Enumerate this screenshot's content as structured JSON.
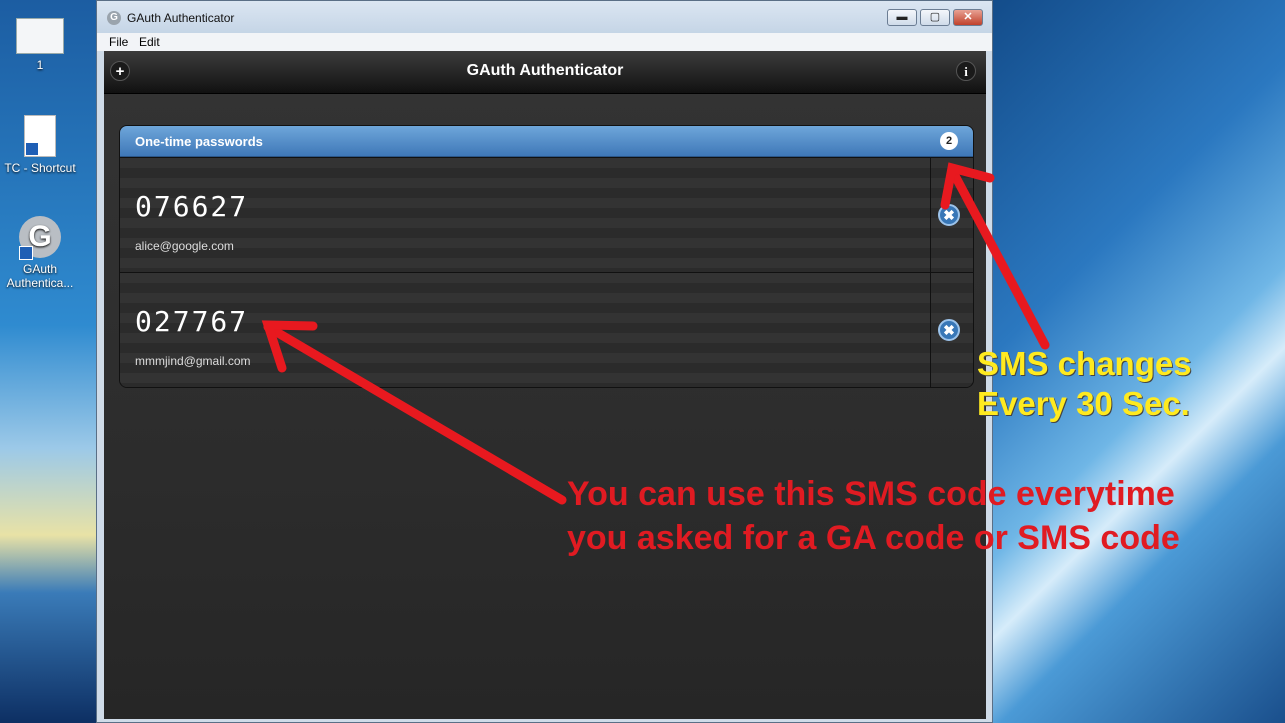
{
  "desktop": {
    "icons": [
      {
        "label": "1"
      },
      {
        "label": "TC - Shortcut"
      },
      {
        "label": "GAuth Authentica..."
      }
    ]
  },
  "window": {
    "title": "GAuth Authenticator",
    "controls": {
      "minimize": "▬",
      "maximize": "▢",
      "close": "✕"
    },
    "menu": {
      "file": "File",
      "edit": "Edit"
    }
  },
  "app": {
    "header_title": "GAuth Authenticator",
    "add_icon": "+",
    "info_icon": "i",
    "list_title": "One-time passwords",
    "count": "2",
    "accounts": [
      {
        "code": "076627",
        "email": "alice@google.com"
      },
      {
        "code": "027767",
        "email": "mmmjind@gmail.com"
      }
    ],
    "delete_icon": "✖"
  },
  "annotations": {
    "sms_line1": "SMS changes",
    "sms_line2": "Every 30 Sec.",
    "use_line1": "You can use this SMS code everytime",
    "use_line2": "you asked for a GA code or SMS code",
    "arrow_color": "#e8191f",
    "text_yellow": "#ffea1f"
  }
}
